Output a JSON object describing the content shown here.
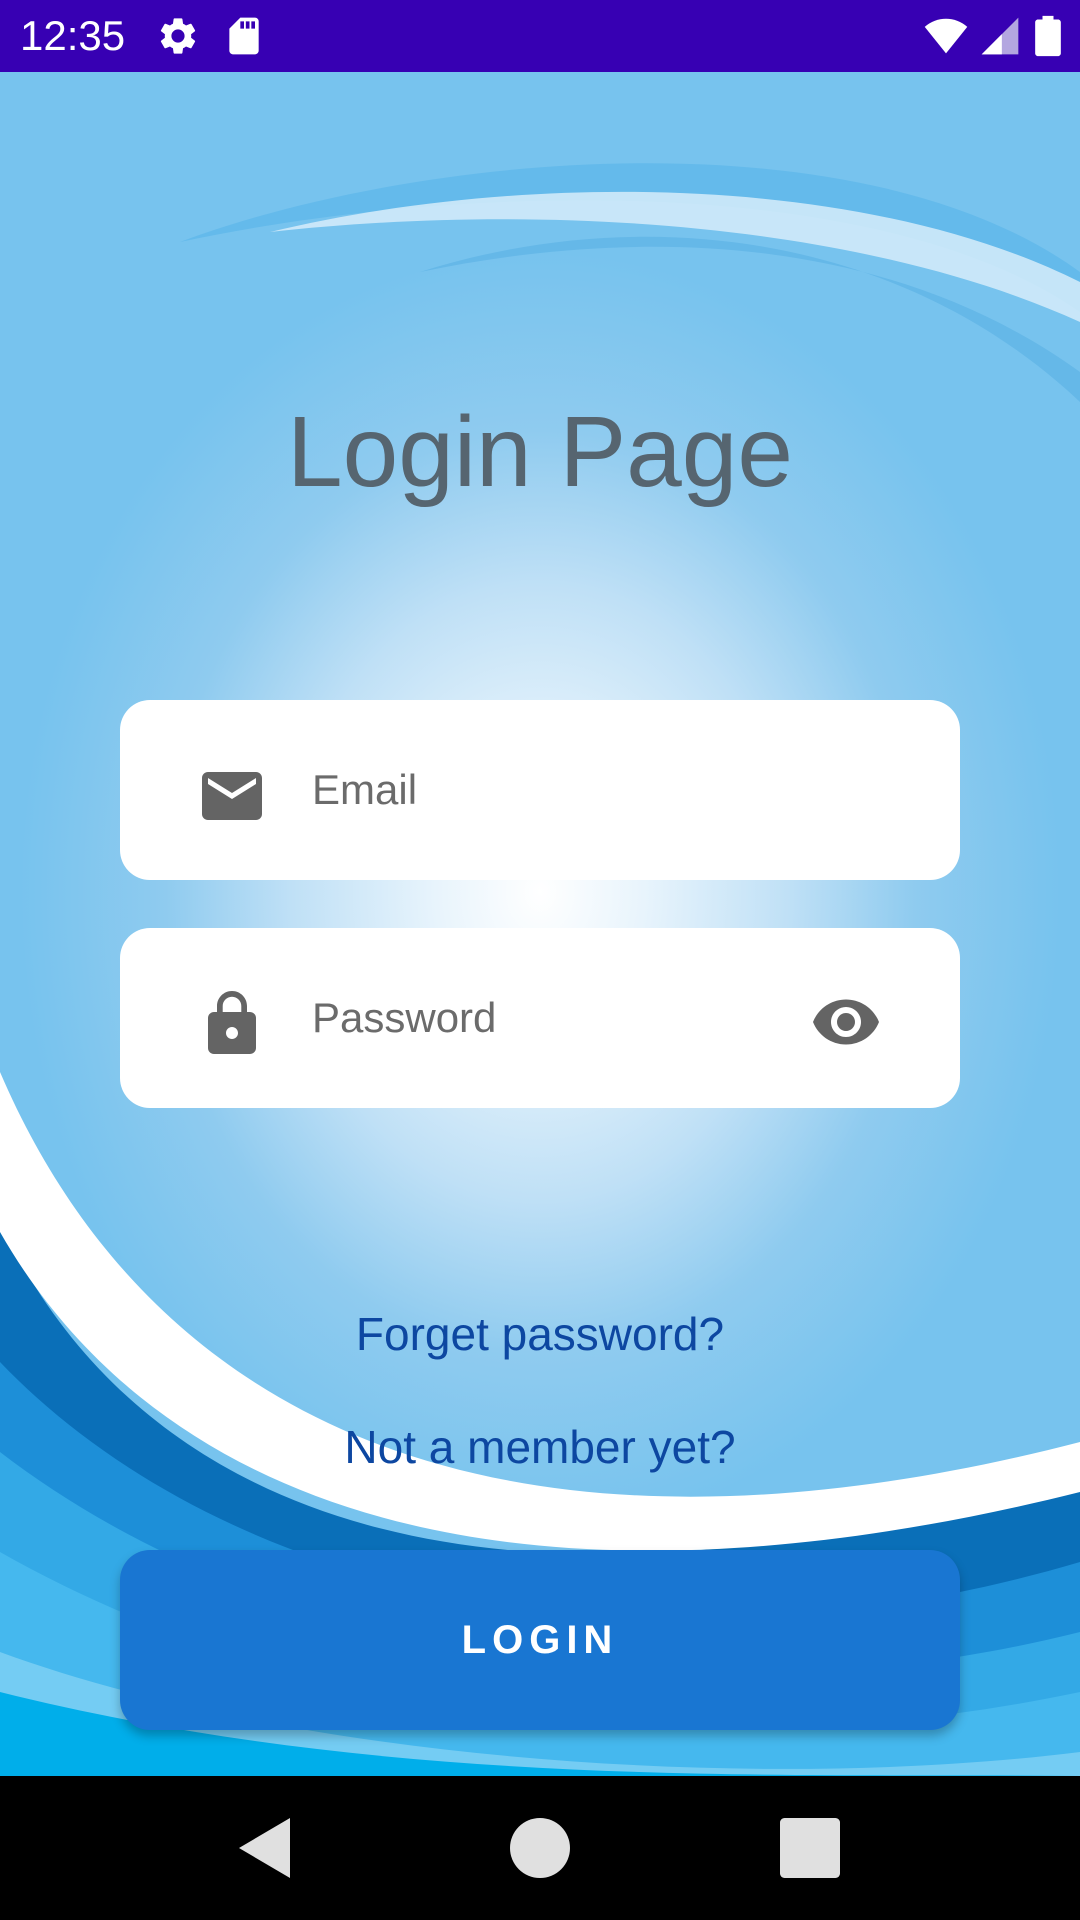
{
  "status_bar": {
    "time": "12:35",
    "background": "#3700b3",
    "icons": [
      "gear-icon",
      "sd-card-icon",
      "wifi-icon",
      "cellular-signal-icon",
      "battery-icon"
    ]
  },
  "login_page": {
    "title": "Login Page",
    "email": {
      "value": "",
      "placeholder": "Email",
      "icon": "envelope-icon"
    },
    "password": {
      "value": "",
      "placeholder": "Password",
      "icon": "lock-icon",
      "toggle_icon": "eye-icon"
    },
    "forget_password_link": "Forget password?",
    "signup_link": "Not a member yet?",
    "login_button": "LOGIN"
  },
  "colors": {
    "accent": "#1976d2",
    "link": "#0d47a1",
    "title": "#566570",
    "background_light": "#ffffff",
    "background_blue": "#77c3ee"
  },
  "nav_bar": {
    "buttons": [
      "back-icon",
      "home-icon",
      "recents-icon"
    ]
  }
}
